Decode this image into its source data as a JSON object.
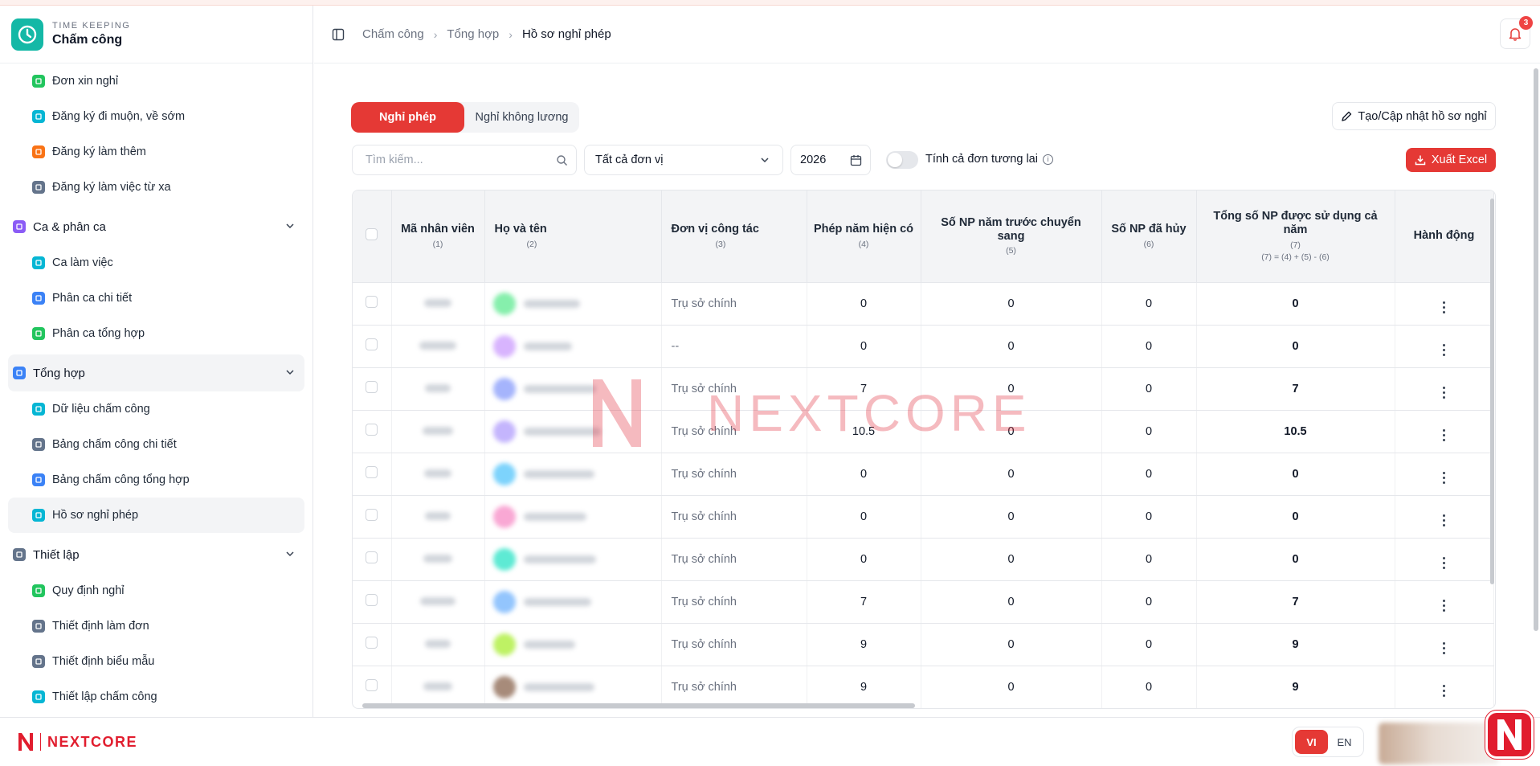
{
  "brand": {
    "subtitle": "TIME KEEPING",
    "title": "Chấm công"
  },
  "sidebar": {
    "items_top": [
      {
        "label": "Đơn xin nghỉ",
        "icon": "calendar-icon",
        "color": "#22c55e"
      },
      {
        "label": "Đăng ký đi muộn, về sớm",
        "icon": "clock-icon",
        "color": "#06b6d4"
      },
      {
        "label": "Đăng ký làm thêm",
        "icon": "overtime-icon",
        "color": "#f97316"
      },
      {
        "label": "Đăng ký làm việc từ xa",
        "icon": "remote-icon",
        "color": "#64748b"
      }
    ],
    "groups": [
      {
        "label": "Ca & phân ca",
        "icon": "calendar-grid-icon",
        "color": "#8b5cf6",
        "items": [
          {
            "label": "Ca làm việc",
            "icon": "clock-icon",
            "color": "#06b6d4"
          },
          {
            "label": "Phân ca chi tiết",
            "icon": "users-icon",
            "color": "#3b82f6"
          },
          {
            "label": "Phân ca tổng hợp",
            "icon": "calendar-icon",
            "color": "#22c55e"
          }
        ]
      },
      {
        "label": "Tổng hợp",
        "icon": "bar-chart-icon",
        "color": "#3b82f6",
        "items": [
          {
            "label": "Dữ liệu chấm công",
            "icon": "clock-icon",
            "color": "#06b6d4"
          },
          {
            "label": "Bảng chấm công chi tiết",
            "icon": "document-icon",
            "color": "#64748b"
          },
          {
            "label": "Bảng chấm công tổng hợp",
            "icon": "chart-icon",
            "color": "#3b82f6"
          },
          {
            "label": "Hồ sơ nghỉ phép",
            "icon": "clock-icon",
            "color": "#06b6d4"
          }
        ]
      },
      {
        "label": "Thiết lập",
        "icon": "gear-icon",
        "color": "#64748b",
        "items": [
          {
            "label": "Quy định nghỉ",
            "icon": "calendar-icon",
            "color": "#22c55e"
          },
          {
            "label": "Thiết định làm đơn",
            "icon": "gear-icon",
            "color": "#64748b"
          },
          {
            "label": "Thiết định biểu mẫu",
            "icon": "document-icon",
            "color": "#64748b"
          },
          {
            "label": "Thiết lập chấm công",
            "icon": "settings-chat-icon",
            "color": "#06b6d4"
          }
        ]
      }
    ]
  },
  "breadcrumb": [
    "Chấm công",
    "Tổng hợp",
    "Hồ sơ nghỉ phép"
  ],
  "notifications": {
    "count": "3"
  },
  "tabs": {
    "active": "Nghỉ phép",
    "inactive": "Nghỉ không lương"
  },
  "actions": {
    "create": "Tạo/Cập nhật hồ sơ nghỉ",
    "export": "Xuất Excel"
  },
  "filters": {
    "search_placeholder": "Tìm kiếm...",
    "unit": "Tất cả đơn vị",
    "year": "2026",
    "toggle_label": "Tính cả đơn tương lai"
  },
  "table": {
    "headers": {
      "code": {
        "label": "Mã nhân viên",
        "num": "(1)"
      },
      "name": {
        "label": "Họ và tên",
        "num": "(2)"
      },
      "unit": {
        "label": "Đơn vị công tác",
        "num": "(3)"
      },
      "current": {
        "label": "Phép năm hiện có",
        "num": "(4)"
      },
      "carried": {
        "label": "Số NP năm trước chuyển sang",
        "num": "(5)"
      },
      "cancelled": {
        "label": "Số NP đã hủy",
        "num": "(6)"
      },
      "total": {
        "label": "Tổng số NP được sử dụng cả năm",
        "num": "(7)",
        "formula": "(7) = (4) + (5) - (6)"
      },
      "action": {
        "label": "Hành động"
      }
    },
    "rows": [
      {
        "unit": "Trụ sở chính",
        "current": "0",
        "carried": "0",
        "cancelled": "0",
        "total": "0",
        "avatar_color": "#86efac"
      },
      {
        "unit": "--",
        "current": "0",
        "carried": "0",
        "cancelled": "0",
        "total": "0",
        "avatar_color": "#d8b4fe"
      },
      {
        "unit": "Trụ sở chính",
        "current": "7",
        "carried": "0",
        "cancelled": "0",
        "total": "7",
        "avatar_color": "#a5b4fc"
      },
      {
        "unit": "Trụ sở chính",
        "current": "10.5",
        "carried": "0",
        "cancelled": "0",
        "total": "10.5",
        "avatar_color": "#c4b5fd"
      },
      {
        "unit": "Trụ sở chính",
        "current": "0",
        "carried": "0",
        "cancelled": "0",
        "total": "0",
        "avatar_color": "#7dd3fc"
      },
      {
        "unit": "Trụ sở chính",
        "current": "0",
        "carried": "0",
        "cancelled": "0",
        "total": "0",
        "avatar_color": "#f9a8d4"
      },
      {
        "unit": "Trụ sở chính",
        "current": "0",
        "carried": "0",
        "cancelled": "0",
        "total": "0",
        "avatar_color": "#5eead4"
      },
      {
        "unit": "Trụ sở chính",
        "current": "7",
        "carried": "0",
        "cancelled": "0",
        "total": "7",
        "avatar_color": "#93c5fd"
      },
      {
        "unit": "Trụ sở chính",
        "current": "9",
        "carried": "0",
        "cancelled": "0",
        "total": "9",
        "avatar_color": "#bef264"
      },
      {
        "unit": "Trụ sở chính",
        "current": "9",
        "carried": "0",
        "cancelled": "0",
        "total": "9",
        "avatar_color": "#a78b7a"
      }
    ]
  },
  "footer": {
    "brand": "NEXTCORE",
    "lang_active": "VI",
    "lang_inactive": "EN"
  },
  "watermark": {
    "text": "NEXTCORE"
  },
  "colors": {
    "accent": "#e53935",
    "brand_red": "#e11d2e",
    "teal": "#14b8a6"
  }
}
